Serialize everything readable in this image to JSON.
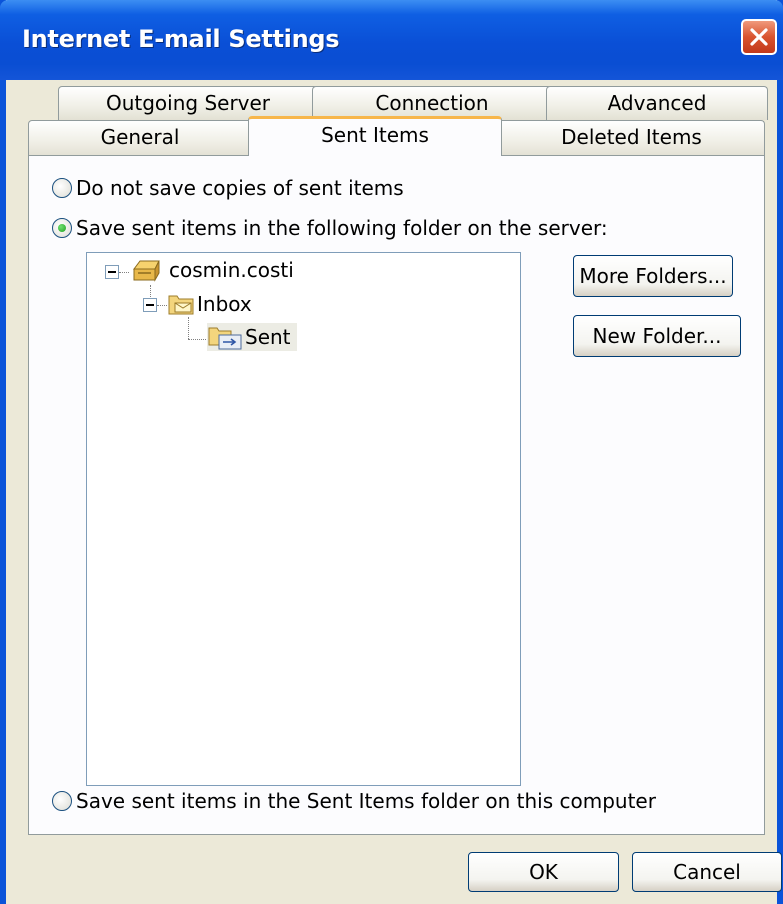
{
  "window": {
    "title": "Internet E-mail Settings"
  },
  "tabs": {
    "row1": [
      "Outgoing Server",
      "Connection",
      "Advanced"
    ],
    "row2": [
      "General",
      "Sent Items",
      "Deleted Items"
    ],
    "active": "Sent Items"
  },
  "options": {
    "no_save": {
      "label": "Do not save copies of sent items",
      "checked": false
    },
    "server_folder": {
      "label": "Save sent items in the following folder on the server:",
      "checked": true
    },
    "local_folder": {
      "label": "Save sent items in the Sent Items folder on this computer",
      "checked": false
    }
  },
  "tree": {
    "root": "cosmin.costi",
    "inbox": "Inbox",
    "sent": "Sent",
    "selected": "Sent"
  },
  "buttons": {
    "more_folders": "More Folders...",
    "new_folder": "New Folder...",
    "ok": "OK",
    "cancel": "Cancel"
  },
  "colors": {
    "titlebar": "#0A4FD6",
    "active_tab_accent": "#F7B64A",
    "close": "#D9542F"
  }
}
